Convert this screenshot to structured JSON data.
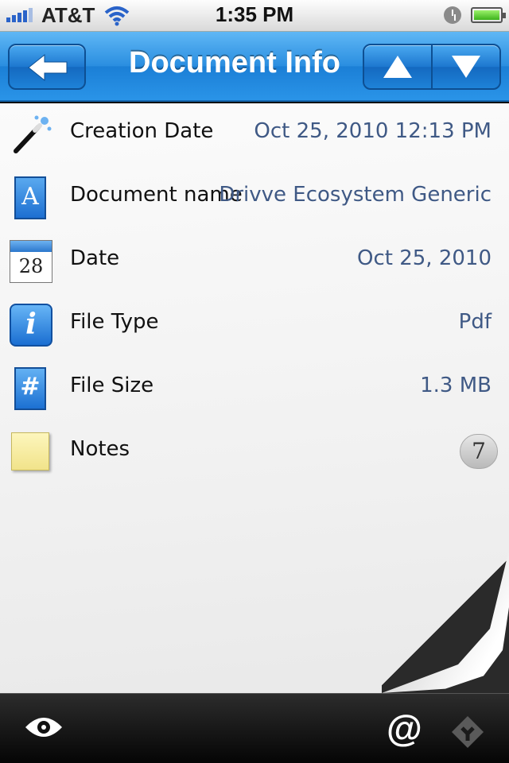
{
  "status_bar": {
    "carrier": "AT&T",
    "time": "1:35 PM",
    "signal_icon": "signal-bars-icon",
    "wifi_icon": "wifi-icon",
    "alarm_icon": "alarm-clock-icon",
    "battery_icon": "battery-full-icon"
  },
  "nav_bar": {
    "title": "Document Info",
    "back_icon": "back-arrow-icon",
    "up_icon": "up-triangle-icon",
    "down_icon": "down-triangle-icon",
    "accent_color": "#2a8ee0"
  },
  "info_rows": [
    {
      "icon": "magic-wand-icon",
      "label": "Creation Date",
      "value": "Oct 25, 2010 12:13 PM"
    },
    {
      "icon": "letter-a-icon",
      "icon_text": "A",
      "label": "Document name",
      "value": "Drivve Ecosystem Generic"
    },
    {
      "icon": "calendar-icon",
      "icon_text": "28",
      "label": "Date",
      "value": "Oct 25, 2010"
    },
    {
      "icon": "info-book-icon",
      "icon_text": "i",
      "label": "File Type",
      "value": "Pdf"
    },
    {
      "icon": "hash-icon",
      "icon_text": "#",
      "label": "File Size",
      "value": "1.3 MB"
    },
    {
      "icon": "sticky-note-icon",
      "label": "Notes",
      "badge": "7"
    }
  ],
  "toolbar": {
    "eye_icon": "eye-icon",
    "at_icon": "at-sign-icon",
    "at_text": "@",
    "share_icon": "diamond-share-icon"
  },
  "value_color": "#3f5985"
}
